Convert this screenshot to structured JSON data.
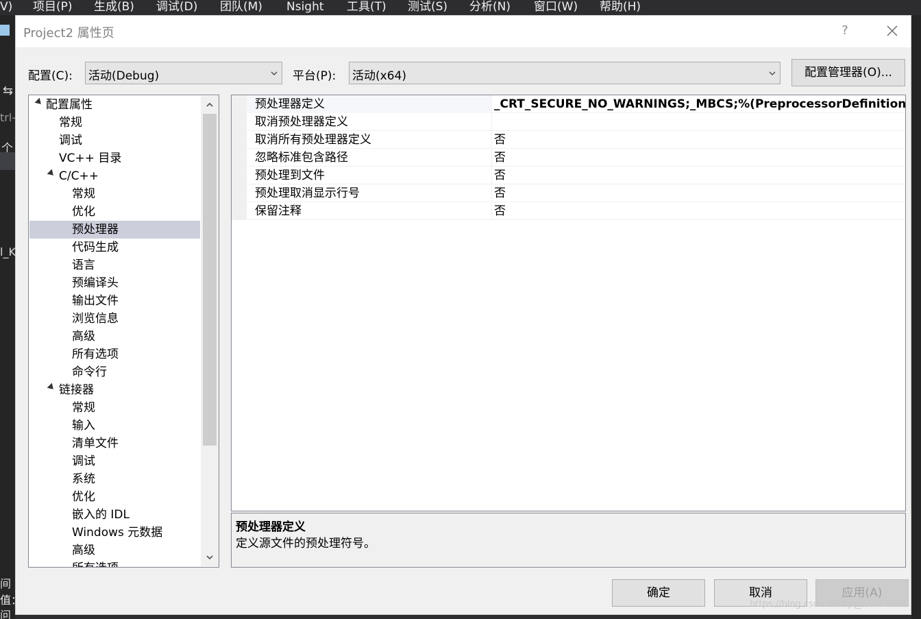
{
  "menubar": {
    "items": [
      "V)",
      "项目(P)",
      "生成(B)",
      "调试(D)",
      "团队(M)",
      "Nsight",
      "工具(T)",
      "测试(S)",
      "分析(N)",
      "窗口(W)",
      "帮助(H)"
    ]
  },
  "background_fragments": [
    "trl-",
    "个",
    "l_K",
    "间值",
    "值：",
    "问值"
  ],
  "dialog": {
    "title": "Project2 属性页",
    "help_label": "?",
    "config_label": "配置(C):",
    "config_value": "活动(Debug)",
    "platform_label": "平台(P):",
    "platform_value": "活动(x64)",
    "config_manager_label": "配置管理器(O)...",
    "ok_label": "确定",
    "cancel_label": "取消",
    "apply_label": "应用(A)"
  },
  "tree": {
    "root": "配置属性",
    "items": [
      "常规",
      "调试",
      "VC++ 目录"
    ],
    "cpp": {
      "label": "C/C++",
      "items": [
        "常规",
        "优化",
        "预处理器",
        "代码生成",
        "语言",
        "预编译头",
        "输出文件",
        "浏览信息",
        "高级",
        "所有选项",
        "命令行"
      ]
    },
    "linker": {
      "label": "链接器",
      "items": [
        "常规",
        "输入",
        "清单文件",
        "调试",
        "系统",
        "优化",
        "嵌入的 IDL",
        "Windows 元数据",
        "高级",
        "所有选项"
      ]
    },
    "selected": "预处理器"
  },
  "properties": [
    {
      "name": "预处理器定义",
      "value": "_CRT_SECURE_NO_WARNINGS;_MBCS;%(PreprocessorDefinitions)"
    },
    {
      "name": "取消预处理器定义",
      "value": ""
    },
    {
      "name": "取消所有预处理器定义",
      "value": "否"
    },
    {
      "name": "忽略标准包含路径",
      "value": "否"
    },
    {
      "name": "预处理到文件",
      "value": "否"
    },
    {
      "name": "预处理取消显示行号",
      "value": "否"
    },
    {
      "name": "保留注释",
      "value": "否"
    }
  ],
  "description": {
    "title": "预处理器定义",
    "text": "定义源文件的预处理符号。"
  },
  "watermark": "https://blog.csdn.net/qq_41223014"
}
